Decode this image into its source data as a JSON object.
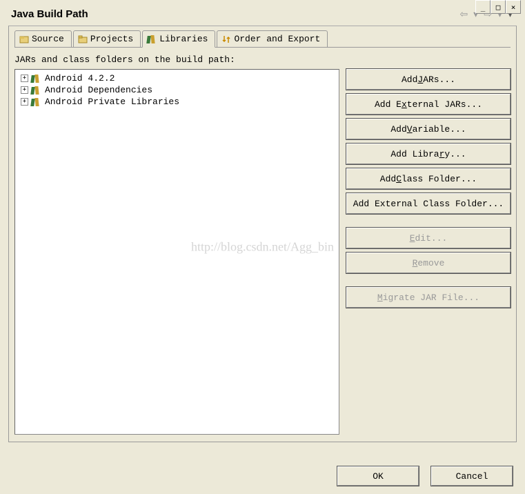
{
  "window": {
    "minimize": "_",
    "maximize": "□",
    "close": "×"
  },
  "header": {
    "title": "Java Build Path"
  },
  "tabs": {
    "source": "Source",
    "projects": "Projects",
    "libraries": "Libraries",
    "order_export": "Order and Export"
  },
  "tree": {
    "label": "JARs and class folders on the build path:",
    "items": [
      {
        "expander": "+",
        "label": "Android 4.2.2"
      },
      {
        "expander": "+",
        "label": "Android Dependencies"
      },
      {
        "expander": "+",
        "label": "Android Private Libraries"
      }
    ]
  },
  "buttons": {
    "add_jars_pre": "Add ",
    "add_jars_u": "J",
    "add_jars_post": "ARs...",
    "add_ext_jars_pre": "Add E",
    "add_ext_jars_u": "x",
    "add_ext_jars_post": "ternal JARs...",
    "add_var_pre": "Add ",
    "add_var_u": "V",
    "add_var_post": "ariable...",
    "add_lib_pre": "Add Libra",
    "add_lib_u": "r",
    "add_lib_post": "y...",
    "add_class_pre": "Add ",
    "add_class_u": "C",
    "add_class_post": "lass Folder...",
    "add_ext_class": "Add External Class Folder...",
    "edit_u": "E",
    "edit_post": "dit...",
    "remove_u": "R",
    "remove_post": "emove",
    "migrate_u": "M",
    "migrate_post": "igrate JAR File..."
  },
  "footer": {
    "ok": "OK",
    "cancel": "Cancel"
  },
  "watermark": "http://blog.csdn.net/Agg_bin"
}
